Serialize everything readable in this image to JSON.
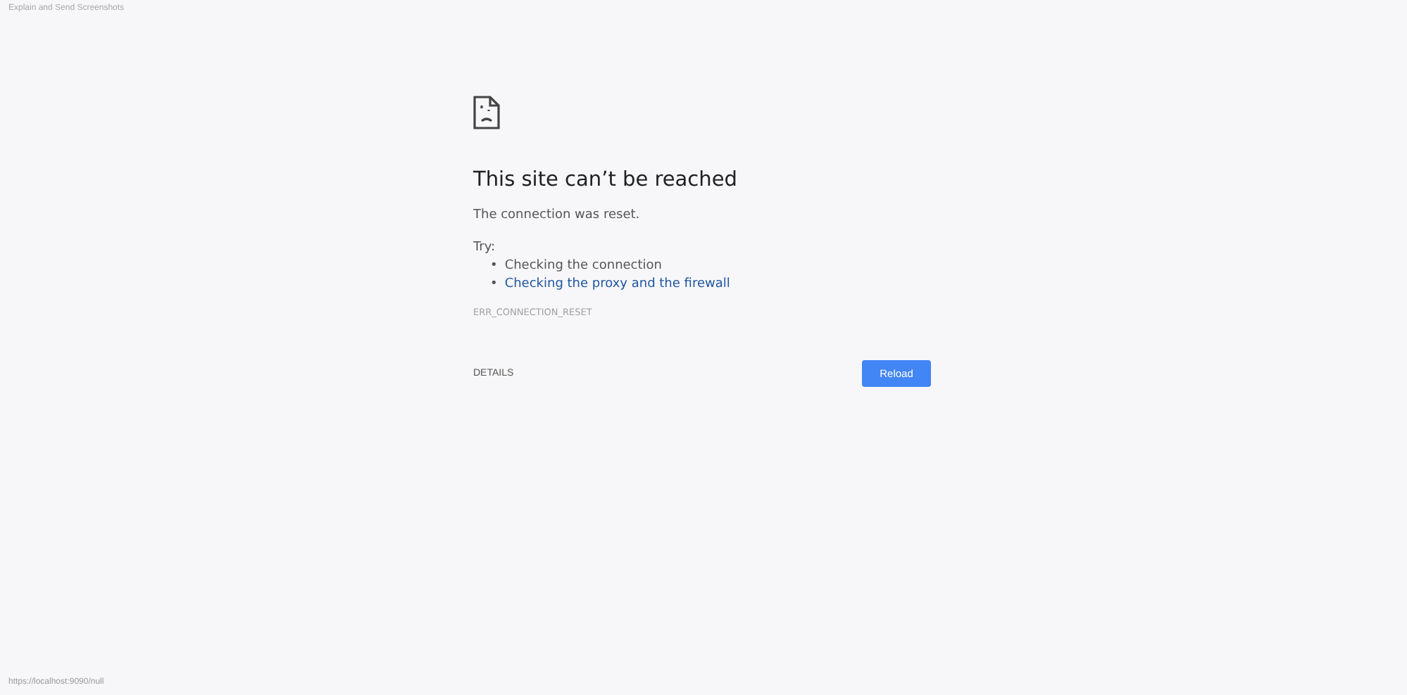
{
  "top_label": "Explain and Send Screenshots",
  "heading": "This site can’t be reached",
  "message": "The connection was reset.",
  "try_label": "Try:",
  "suggestions": [
    {
      "bullet": "•",
      "text": "Checking the connection",
      "kind": "text"
    },
    {
      "bullet": "•",
      "text": "Checking the proxy and the firewall",
      "kind": "link"
    }
  ],
  "error_code": "ERR_CONNECTION_RESET",
  "details_button": "DETAILS",
  "reload_button": "Reload",
  "status_url": "https://localhost:9090/null"
}
